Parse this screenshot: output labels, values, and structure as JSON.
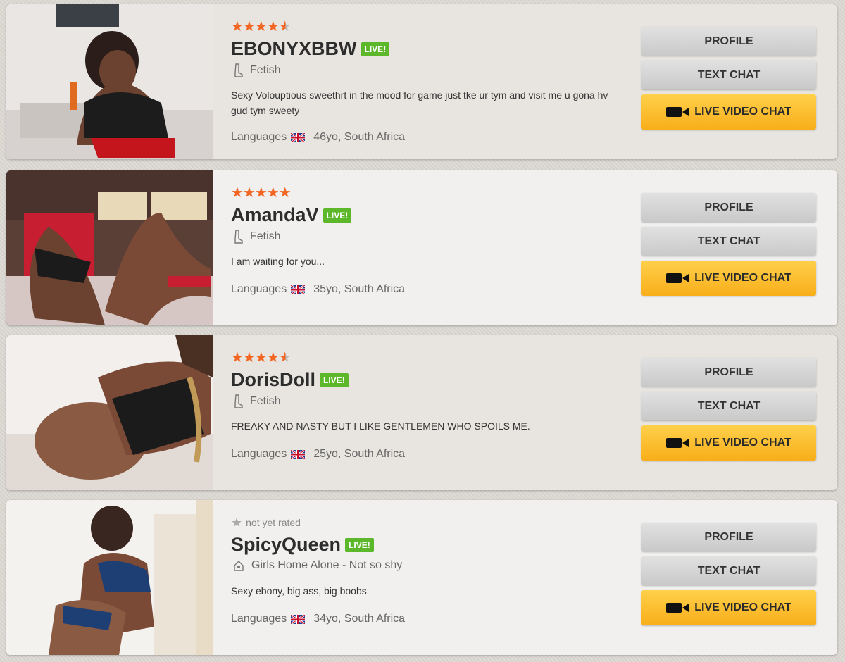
{
  "buttons": {
    "profile": "PROFILE",
    "text_chat": "TEXT CHAT",
    "live_video_chat": "LIVE VIDEO CHAT"
  },
  "live_badge": "LIVE!",
  "languages_label": "Languages",
  "colors": {
    "star": "#f26522",
    "live_badge": "#5cb82a",
    "live_button": "#fbbd2c"
  },
  "performers": [
    {
      "name": "EBONYXBBW",
      "rating": 4.5,
      "rating_text": "",
      "category": "Fetish",
      "category_icon": "boot-icon",
      "description": "Sexy Volouptious sweethrt in the mood for game just tke ur tym and visit me u gona hv gud tym sweety",
      "age_location": "46yo, South Africa",
      "language_flag": "uk-flag-icon"
    },
    {
      "name": "AmandaV",
      "rating": 5,
      "rating_text": "",
      "category": "Fetish",
      "category_icon": "boot-icon",
      "description": "I am waiting for you...",
      "age_location": "35yo, South Africa",
      "language_flag": "uk-flag-icon"
    },
    {
      "name": "DorisDoll",
      "rating": 4.5,
      "rating_text": "",
      "category": "Fetish",
      "category_icon": "boot-icon",
      "description": "FREAKY AND NASTY BUT I LIKE GENTLEMEN WHO SPOILS ME.",
      "age_location": "25yo, South Africa",
      "language_flag": "uk-flag-icon"
    },
    {
      "name": "SpicyQueen",
      "rating": null,
      "rating_text": "not yet rated",
      "category": "Girls Home Alone - Not so shy",
      "category_icon": "house-icon",
      "description": "Sexy ebony, big ass, big boobs",
      "age_location": "34yo, South Africa",
      "language_flag": "uk-flag-icon"
    }
  ]
}
